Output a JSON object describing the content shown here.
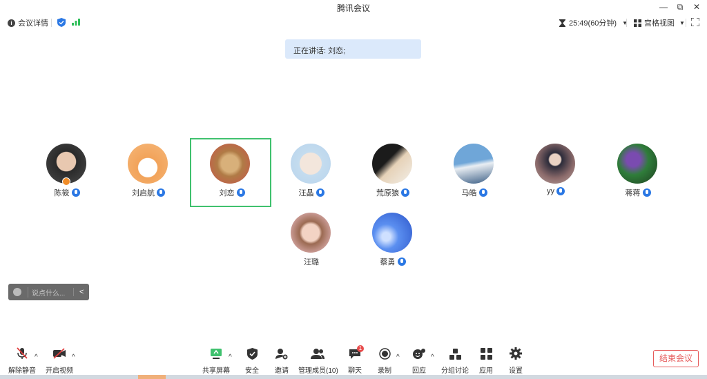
{
  "window": {
    "title": "腾讯会议",
    "minimize_glyph": "—",
    "restore_glyph": "⧉",
    "close_glyph": "✕"
  },
  "infobar": {
    "meeting_details": "会议详情",
    "timer": "25:49(60分钟)",
    "view_mode": "宫格视图",
    "signal_color": "#2fbf5a",
    "shield_color": "#2b78e4"
  },
  "speaking_banner": "正在讲话: 刘恋;",
  "participants": [
    {
      "name": "陈筱",
      "mic": true,
      "host": true
    },
    {
      "name": "刘启航",
      "mic": true
    },
    {
      "name": "刘恋",
      "mic": true,
      "speaking": true
    },
    {
      "name": "汪晶",
      "mic": true
    },
    {
      "name": "荒原狼",
      "mic": true
    },
    {
      "name": "马皓",
      "mic": true
    },
    {
      "name": "yy",
      "mic": true
    },
    {
      "name": "蒋蒋",
      "mic": true
    },
    {
      "name": "汪璐",
      "mic": false
    },
    {
      "name": "蔡勇",
      "mic": true
    }
  ],
  "chat": {
    "placeholder": "说点什么...",
    "collapse_glyph": "<"
  },
  "toolbar": {
    "unmute": "解除静音",
    "start_video": "开启视频",
    "share_screen": "共享屏幕",
    "security": "安全",
    "invite": "邀请",
    "manage_members": "管理成员(10)",
    "chat": "聊天",
    "chat_badge": "1",
    "record": "录制",
    "reactions": "回应",
    "breakout": "分组讨论",
    "apps": "应用",
    "settings": "设置",
    "end_meeting": "结束会议",
    "accent_green": "#3fc16e",
    "accent_red": "#e65a5a"
  }
}
